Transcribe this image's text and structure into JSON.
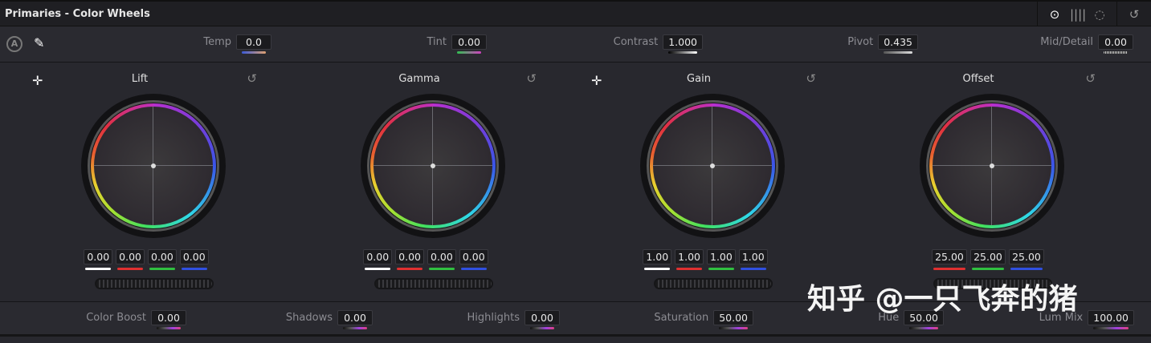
{
  "title": "Primaries - Color Wheels",
  "toolbar_icons": [
    "color-wheels-icon",
    "bars-icon",
    "log-wheels-icon",
    "reset-all-icon"
  ],
  "toolbar": {
    "params": [
      {
        "label": "Temp",
        "value": "0.0",
        "bar": "linear-gradient(90deg,#3a5ad8,#e0a070)"
      },
      {
        "label": "Tint",
        "value": "0.00",
        "bar": "linear-gradient(90deg,#30c050,#d040c0)"
      },
      {
        "label": "Contrast",
        "value": "1.000",
        "bar": "linear-gradient(90deg,#000,#fff)"
      },
      {
        "label": "Pivot",
        "value": "0.435",
        "bar": "linear-gradient(90deg,#555,#ddd)"
      },
      {
        "label": "Mid/Detail",
        "value": "0.00",
        "bar": "repeating-linear-gradient(90deg,#ccc 0 1px,#333 1px 2px)"
      }
    ]
  },
  "wheels": [
    {
      "label": "Lift",
      "values": [
        "0.00",
        "0.00",
        "0.00",
        "0.00"
      ]
    },
    {
      "label": "Gamma",
      "values": [
        "0.00",
        "0.00",
        "0.00",
        "0.00"
      ]
    },
    {
      "label": "Gain",
      "values": [
        "1.00",
        "1.00",
        "1.00",
        "1.00"
      ]
    },
    {
      "label": "Offset",
      "values": [
        "25.00",
        "25.00",
        "25.00"
      ]
    }
  ],
  "channel_colors": [
    "#ffffff",
    "#e03030",
    "#30c040",
    "#3050e0"
  ],
  "bottom": {
    "params": [
      {
        "label": "Color Boost",
        "value": "0.00"
      },
      {
        "label": "Shadows",
        "value": "0.00"
      },
      {
        "label": "Highlights",
        "value": "0.00"
      },
      {
        "label": "Saturation",
        "value": "50.00"
      },
      {
        "label": "Hue",
        "value": "50.00"
      },
      {
        "label": "Lum Mix",
        "value": "100.00"
      }
    ]
  },
  "watermark": "知乎 @一只飞奔的猪"
}
